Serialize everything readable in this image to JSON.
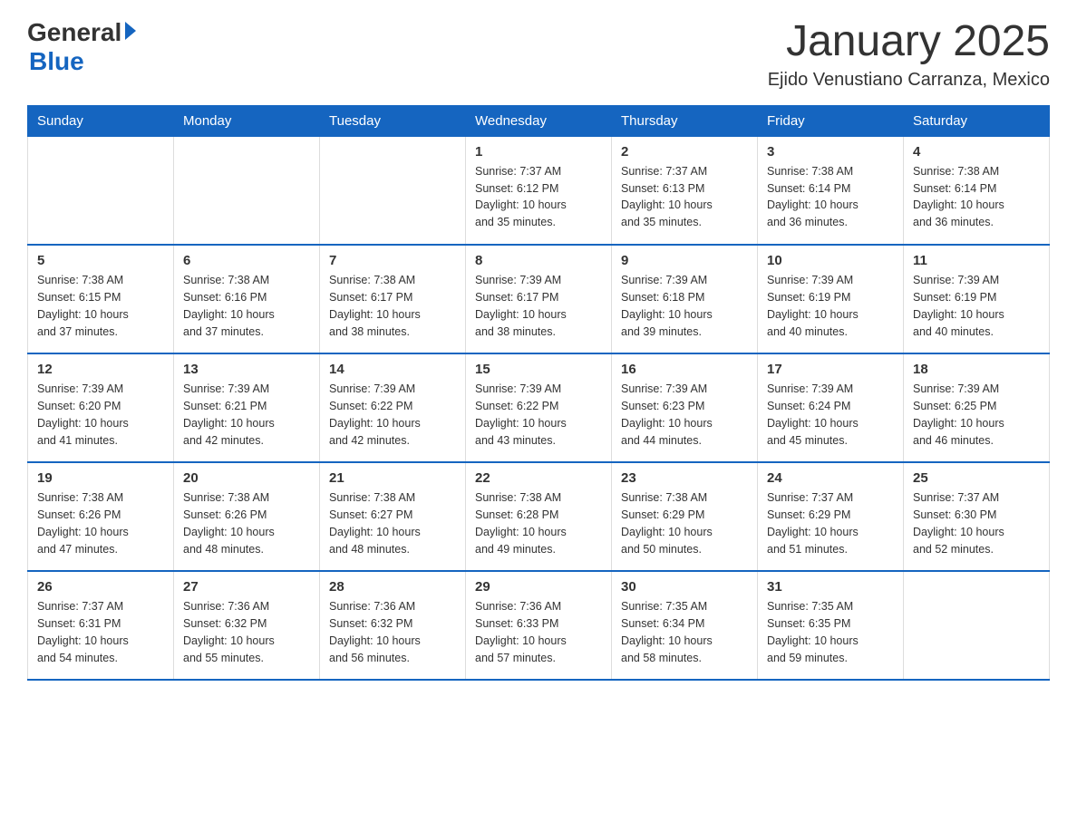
{
  "header": {
    "logo_general": "General",
    "logo_blue": "Blue",
    "month_title": "January 2025",
    "location": "Ejido Venustiano Carranza, Mexico"
  },
  "weekdays": [
    "Sunday",
    "Monday",
    "Tuesday",
    "Wednesday",
    "Thursday",
    "Friday",
    "Saturday"
  ],
  "weeks": [
    [
      {
        "day": "",
        "info": ""
      },
      {
        "day": "",
        "info": ""
      },
      {
        "day": "",
        "info": ""
      },
      {
        "day": "1",
        "info": "Sunrise: 7:37 AM\nSunset: 6:12 PM\nDaylight: 10 hours\nand 35 minutes."
      },
      {
        "day": "2",
        "info": "Sunrise: 7:37 AM\nSunset: 6:13 PM\nDaylight: 10 hours\nand 35 minutes."
      },
      {
        "day": "3",
        "info": "Sunrise: 7:38 AM\nSunset: 6:14 PM\nDaylight: 10 hours\nand 36 minutes."
      },
      {
        "day": "4",
        "info": "Sunrise: 7:38 AM\nSunset: 6:14 PM\nDaylight: 10 hours\nand 36 minutes."
      }
    ],
    [
      {
        "day": "5",
        "info": "Sunrise: 7:38 AM\nSunset: 6:15 PM\nDaylight: 10 hours\nand 37 minutes."
      },
      {
        "day": "6",
        "info": "Sunrise: 7:38 AM\nSunset: 6:16 PM\nDaylight: 10 hours\nand 37 minutes."
      },
      {
        "day": "7",
        "info": "Sunrise: 7:38 AM\nSunset: 6:17 PM\nDaylight: 10 hours\nand 38 minutes."
      },
      {
        "day": "8",
        "info": "Sunrise: 7:39 AM\nSunset: 6:17 PM\nDaylight: 10 hours\nand 38 minutes."
      },
      {
        "day": "9",
        "info": "Sunrise: 7:39 AM\nSunset: 6:18 PM\nDaylight: 10 hours\nand 39 minutes."
      },
      {
        "day": "10",
        "info": "Sunrise: 7:39 AM\nSunset: 6:19 PM\nDaylight: 10 hours\nand 40 minutes."
      },
      {
        "day": "11",
        "info": "Sunrise: 7:39 AM\nSunset: 6:19 PM\nDaylight: 10 hours\nand 40 minutes."
      }
    ],
    [
      {
        "day": "12",
        "info": "Sunrise: 7:39 AM\nSunset: 6:20 PM\nDaylight: 10 hours\nand 41 minutes."
      },
      {
        "day": "13",
        "info": "Sunrise: 7:39 AM\nSunset: 6:21 PM\nDaylight: 10 hours\nand 42 minutes."
      },
      {
        "day": "14",
        "info": "Sunrise: 7:39 AM\nSunset: 6:22 PM\nDaylight: 10 hours\nand 42 minutes."
      },
      {
        "day": "15",
        "info": "Sunrise: 7:39 AM\nSunset: 6:22 PM\nDaylight: 10 hours\nand 43 minutes."
      },
      {
        "day": "16",
        "info": "Sunrise: 7:39 AM\nSunset: 6:23 PM\nDaylight: 10 hours\nand 44 minutes."
      },
      {
        "day": "17",
        "info": "Sunrise: 7:39 AM\nSunset: 6:24 PM\nDaylight: 10 hours\nand 45 minutes."
      },
      {
        "day": "18",
        "info": "Sunrise: 7:39 AM\nSunset: 6:25 PM\nDaylight: 10 hours\nand 46 minutes."
      }
    ],
    [
      {
        "day": "19",
        "info": "Sunrise: 7:38 AM\nSunset: 6:26 PM\nDaylight: 10 hours\nand 47 minutes."
      },
      {
        "day": "20",
        "info": "Sunrise: 7:38 AM\nSunset: 6:26 PM\nDaylight: 10 hours\nand 48 minutes."
      },
      {
        "day": "21",
        "info": "Sunrise: 7:38 AM\nSunset: 6:27 PM\nDaylight: 10 hours\nand 48 minutes."
      },
      {
        "day": "22",
        "info": "Sunrise: 7:38 AM\nSunset: 6:28 PM\nDaylight: 10 hours\nand 49 minutes."
      },
      {
        "day": "23",
        "info": "Sunrise: 7:38 AM\nSunset: 6:29 PM\nDaylight: 10 hours\nand 50 minutes."
      },
      {
        "day": "24",
        "info": "Sunrise: 7:37 AM\nSunset: 6:29 PM\nDaylight: 10 hours\nand 51 minutes."
      },
      {
        "day": "25",
        "info": "Sunrise: 7:37 AM\nSunset: 6:30 PM\nDaylight: 10 hours\nand 52 minutes."
      }
    ],
    [
      {
        "day": "26",
        "info": "Sunrise: 7:37 AM\nSunset: 6:31 PM\nDaylight: 10 hours\nand 54 minutes."
      },
      {
        "day": "27",
        "info": "Sunrise: 7:36 AM\nSunset: 6:32 PM\nDaylight: 10 hours\nand 55 minutes."
      },
      {
        "day": "28",
        "info": "Sunrise: 7:36 AM\nSunset: 6:32 PM\nDaylight: 10 hours\nand 56 minutes."
      },
      {
        "day": "29",
        "info": "Sunrise: 7:36 AM\nSunset: 6:33 PM\nDaylight: 10 hours\nand 57 minutes."
      },
      {
        "day": "30",
        "info": "Sunrise: 7:35 AM\nSunset: 6:34 PM\nDaylight: 10 hours\nand 58 minutes."
      },
      {
        "day": "31",
        "info": "Sunrise: 7:35 AM\nSunset: 6:35 PM\nDaylight: 10 hours\nand 59 minutes."
      },
      {
        "day": "",
        "info": ""
      }
    ]
  ]
}
